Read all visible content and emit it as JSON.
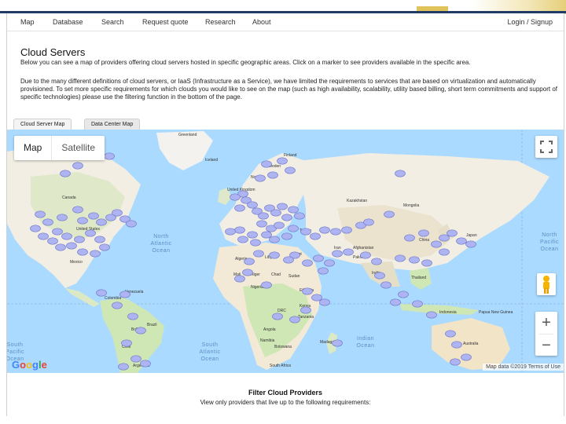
{
  "nav": {
    "items": [
      "Map",
      "Database",
      "Search",
      "Request quote",
      "Research",
      "About"
    ],
    "login": "Login / Signup"
  },
  "page": {
    "title": "Cloud Servers",
    "intro": "Below you can see a map of providers offering cloud servers hosted in specific geographic areas. Click on a marker to see providers available in the specific area.",
    "para2": "Due to the many different definitions of cloud servers, or IaaS (Infrastructure as a Service), we have limited the requirements to services that are based on virtualization and automatically provisioned. To set more specific requirements for which clouds you would like to see on the map (such as high availability, scalability, utility based billing, short term commitments and support of specific technologies) please use the filtering function in the bottom of the page."
  },
  "tabs": [
    "Cloud Server Map",
    "Data Center Map"
  ],
  "map": {
    "type_options": [
      "Map",
      "Satellite"
    ],
    "google": "Google",
    "attribution": "Map data ©2019    Terms of Use",
    "zoom_in": "+",
    "zoom_out": "−",
    "ocean_labels": [
      {
        "id": "na",
        "lines": [
          "North",
          "Atlantic",
          "Ocean"
        ]
      },
      {
        "id": "np",
        "lines": [
          "North",
          "Pacific",
          "Ocean"
        ]
      },
      {
        "id": "sa",
        "lines": [
          "South",
          "Atlantic",
          "Ocean"
        ]
      },
      {
        "id": "io",
        "lines": [
          "Indian",
          "Ocean"
        ]
      },
      {
        "id": "sp",
        "lines": [
          "South",
          "Pacific",
          "Ocean"
        ]
      }
    ],
    "country_labels": [
      "Greenland",
      "Iceland",
      "Finland",
      "Sweden",
      "Norway",
      "United Kingdom",
      "Canada",
      "United States",
      "Mexico",
      "Colombia",
      "Venezuela",
      "Brazil",
      "Bolivia",
      "Chile",
      "Argentina",
      "Algeria",
      "Libya",
      "Egypt",
      "Mali",
      "Niger",
      "Chad",
      "Sudan",
      "Nigeria",
      "Ethiopia",
      "Kenya",
      "DRC",
      "Tanzania",
      "Angola",
      "Namibia",
      "Botswana",
      "South Africa",
      "Madagascar",
      "Kazakhstan",
      "Mongolia",
      "China",
      "Japan",
      "Iran",
      "Afghanistan",
      "Pakistan",
      "India",
      "Thailand",
      "Indonesia",
      "Papua New Guinea",
      "Australia",
      "Turkey"
    ]
  },
  "filter": {
    "title": "Filter Cloud Providers",
    "subtitle": "View only providers that live up to the following requirements:"
  },
  "colors": {
    "water": "#aadaff",
    "land": "#f3efe6",
    "green": "#cfe6b5",
    "marker": "#aeb4f2",
    "marker_stroke": "#6f78c7",
    "accent_navy": "#1f3b66",
    "accent_gold": "#e0c35a"
  },
  "markers_count": 112
}
